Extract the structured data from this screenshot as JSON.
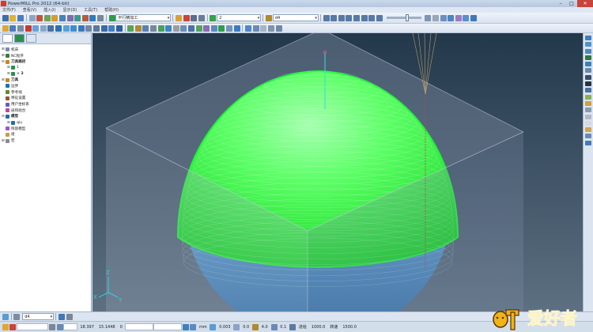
{
  "window": {
    "title": "PowerMILL Pro 2012 (64-bit)",
    "minimize": "–",
    "maximize": "□",
    "close": "✕"
  },
  "menu": [
    "文件(F)",
    "查看(V)",
    "插入(I)",
    "显示(D)",
    "工具(T)",
    "帮助(H)"
  ],
  "toolbar1": {
    "strategy_combo": "平行精加工",
    "toolpath_combo": "2",
    "tool_combo": "d4"
  },
  "explorer": {
    "tree": [
      {
        "label": "机床",
        "icon": "machine-icon",
        "color": "#7a8da6",
        "indent": 0,
        "exp": "⊞"
      },
      {
        "label": "NC程序",
        "icon": "nc-program-icon",
        "color": "#3a7a3a",
        "indent": 0,
        "exp": "⊞"
      },
      {
        "label": "刀具路径",
        "icon": "toolpath-folder-icon",
        "color": "#c48a1a",
        "indent": 0,
        "exp": "⊟",
        "bold": true
      },
      {
        "label": "1",
        "icon": "toolpath-item-icon",
        "color": "#2b8f4a",
        "indent": 1,
        "exp": "⊞"
      },
      {
        "label": "> 2",
        "icon": "toolpath-item-icon",
        "color": "#2b8f4a",
        "indent": 1,
        "exp": "⊞",
        "bold": true
      },
      {
        "label": "刀具",
        "icon": "tool-folder-icon",
        "color": "#c48a1a",
        "indent": 0,
        "exp": "⊞",
        "bold": true
      },
      {
        "label": "边界",
        "icon": "boundary-icon",
        "color": "#1d6fbf",
        "indent": 0,
        "exp": ""
      },
      {
        "label": "参考线",
        "icon": "pattern-icon",
        "color": "#5c8f2e",
        "indent": 0,
        "exp": ""
      },
      {
        "label": "特征设置",
        "icon": "feature-icon",
        "color": "#a0522d",
        "indent": 0,
        "exp": ""
      },
      {
        "label": "用户坐标系",
        "icon": "workplane-icon",
        "color": "#6a5acd",
        "indent": 0,
        "exp": ""
      },
      {
        "label": "层和组合",
        "icon": "levels-icon",
        "color": "#b84a9a",
        "indent": 0,
        "exp": ""
      },
      {
        "label": "模型",
        "icon": "model-folder-icon",
        "color": "#1f6fb0",
        "indent": 0,
        "exp": "⊟",
        "bold": true
      },
      {
        "label": "qiu",
        "icon": "model-item-icon",
        "color": "#1f6fb0",
        "indent": 1,
        "exp": "⊞"
      },
      {
        "label": "残留模型",
        "icon": "stock-model-icon",
        "color": "#a84fcf",
        "indent": 0,
        "exp": ""
      },
      {
        "label": "组",
        "icon": "group-icon",
        "color": "#c3a23b",
        "indent": 0,
        "exp": ""
      },
      {
        "label": "宏",
        "icon": "macro-icon",
        "color": "#8a8a8a",
        "indent": 0,
        "exp": "⊞"
      }
    ]
  },
  "axes": {
    "x": "X",
    "y": "Y",
    "z": "Z"
  },
  "status": {
    "tool_combo": "d4",
    "coord1": "18.397",
    "coord2": "15.1448",
    "coord3": "0",
    "unit": "mm",
    "tolerance": "0.003",
    "thickness": "0.0",
    "diameter": "4.0",
    "stepover": "0.1",
    "feed_label": "进给",
    "feed_value": "1000.0",
    "speed_label": "转速",
    "speed_value": "1500.0"
  },
  "logo_text": "爱好者",
  "colors": {
    "viewport_top": "#23384b",
    "toolpath_green": "#2dff3a",
    "sphere_blue": "#3f86c2",
    "block_gray": "#8b98ae"
  }
}
